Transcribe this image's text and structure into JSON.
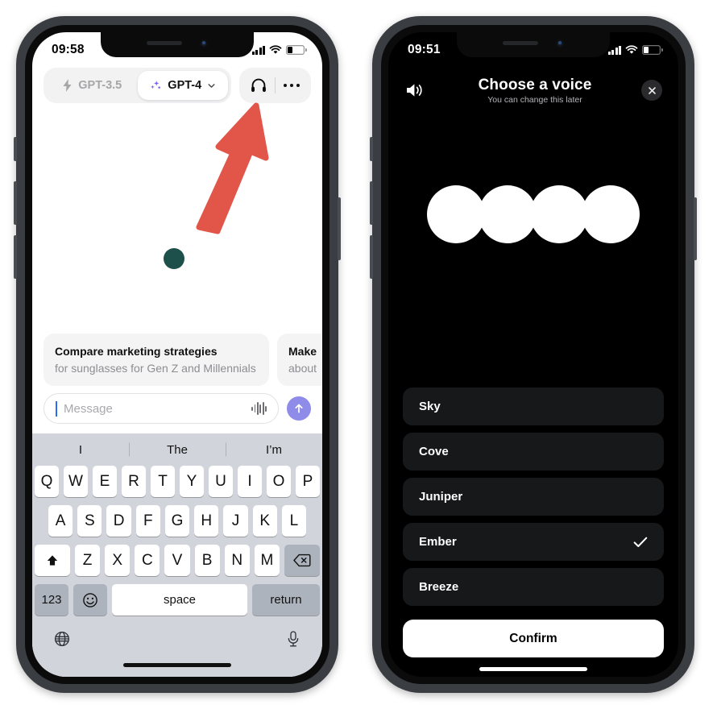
{
  "colors": {
    "accent_purple": "#8e8ce8",
    "sparkle_purple": "#7b5cf0",
    "teal_dot": "#1d4f4b",
    "arrow_red": "#e2564a",
    "keyboard_bg": "#d1d4da",
    "key_white": "#ffffff",
    "key_grey": "#adb3bd",
    "voice_item_bg": "#17181a",
    "phone_frame": "#3a3d42"
  },
  "left_phone": {
    "device_name": "iphone-light",
    "status_bar": {
      "time": "09:58",
      "signal_icon": "cellular-signal-icon",
      "wifi_icon": "wifi-icon",
      "battery_icon": "battery-low-icon",
      "battery_level_pct": 32
    },
    "topbar": {
      "models": [
        {
          "label": "GPT-3.5",
          "icon": "bolt-icon",
          "active": false
        },
        {
          "label": "GPT-4",
          "icon": "sparkle-icon",
          "active": true,
          "chevron": "chevron-down-icon"
        }
      ],
      "headphones_icon": "headphones-icon",
      "more_icon": "ellipsis-icon"
    },
    "canvas": {
      "dot_label": "teal-dot-indicator"
    },
    "suggestions": [
      {
        "title": "Compare marketing strategies",
        "subtitle": "for sunglasses for Gen Z and Millennials"
      },
      {
        "title": "Make",
        "subtitle": "about"
      }
    ],
    "composer": {
      "placeholder": "Message",
      "value": "",
      "waveform_icon": "audio-waveform-icon",
      "send_icon": "arrow-up-icon"
    },
    "keyboard": {
      "predictions": [
        "I",
        "The",
        "I’m"
      ],
      "row1": [
        "Q",
        "W",
        "E",
        "R",
        "T",
        "Y",
        "U",
        "I",
        "O",
        "P"
      ],
      "row2": [
        "A",
        "S",
        "D",
        "F",
        "G",
        "H",
        "J",
        "K",
        "L"
      ],
      "row3": [
        "Z",
        "X",
        "C",
        "V",
        "B",
        "N",
        "M"
      ],
      "shift_icon": "shift-arrow-icon",
      "backspace_icon": "backspace-icon",
      "numbers_label": "123",
      "emoji_icon": "emoji-smiley-icon",
      "space_label": "space",
      "return_label": "return",
      "globe_icon": "globe-icon",
      "dictation_icon": "microphone-icon"
    }
  },
  "right_phone": {
    "device_name": "iphone-dark",
    "status_bar": {
      "time": "09:51",
      "signal_icon": "cellular-signal-icon",
      "wifi_icon": "wifi-icon",
      "battery_icon": "battery-low-icon",
      "battery_level_pct": 32
    },
    "header": {
      "speaker_icon": "speaker-wave-icon",
      "title": "Choose a voice",
      "subtitle": "You can change this later",
      "close_icon": "close-x-icon"
    },
    "visualizer": {
      "label": "voice-orb-visualizer",
      "blob_count": 4
    },
    "voices": [
      {
        "name": "Sky",
        "selected": false
      },
      {
        "name": "Cove",
        "selected": false
      },
      {
        "name": "Juniper",
        "selected": false
      },
      {
        "name": "Ember",
        "selected": true
      },
      {
        "name": "Breeze",
        "selected": false
      }
    ],
    "confirm_label": "Confirm",
    "check_icon": "checkmark-icon"
  },
  "annotation": {
    "arrow_label": "red-callout-arrow",
    "points_at": "headphones-icon"
  }
}
